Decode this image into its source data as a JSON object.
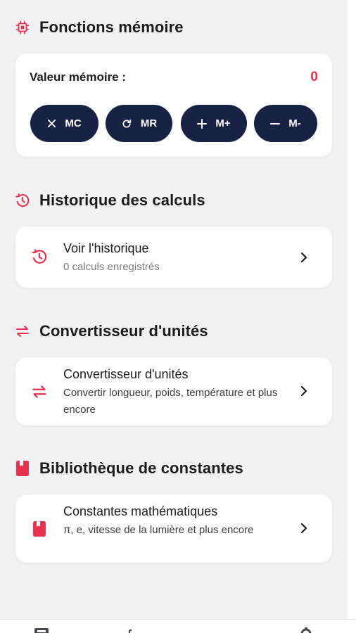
{
  "memory": {
    "title": "Fonctions mémoire",
    "value_label": "Valeur mémoire :",
    "value": "0",
    "buttons": [
      {
        "icon": "close-icon",
        "label": "MC"
      },
      {
        "icon": "refresh-icon",
        "label": "MR"
      },
      {
        "icon": "plus-icon",
        "label": "M+"
      },
      {
        "icon": "minus-icon",
        "label": "M-"
      }
    ]
  },
  "history": {
    "title": "Historique des calculs",
    "item_title": "Voir l'historique",
    "item_subtitle": "0 calculs enregistrés"
  },
  "converter": {
    "title": "Convertisseur d'unités",
    "item_title": "Convertisseur d'unités",
    "item_subtitle": "Convertir longueur, poids, température et plus encore"
  },
  "constants": {
    "title": "Bibliothèque de constantes",
    "item_title": "Constantes mathématiques",
    "item_subtitle": "π, e, vitesse de la lumière et plus encore"
  },
  "bottom_nav": {
    "tabs": [
      {
        "icon": "calculator-icon"
      },
      {
        "icon": "function-icon"
      },
      {
        "icon": "chart-icon"
      },
      {
        "icon": "gear-icon"
      }
    ]
  },
  "colors": {
    "accent": "#e8304f",
    "button_bg": "#172245",
    "background": "#f2f2f4",
    "card": "#ffffff"
  }
}
